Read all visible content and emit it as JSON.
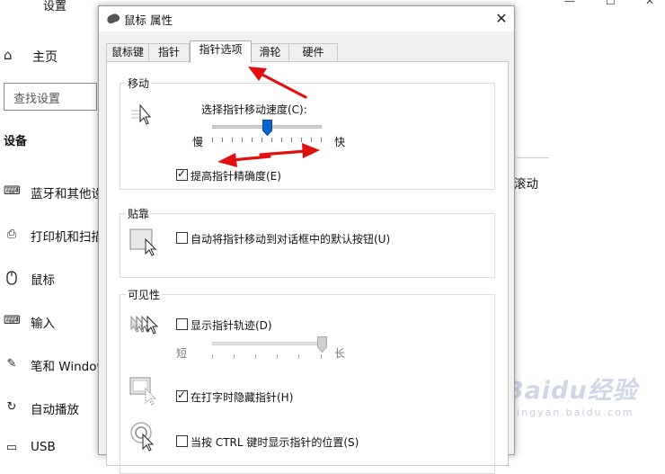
{
  "background": {
    "window_title": "设置",
    "min_glyph": "—",
    "max_glyph": "☐",
    "close_glyph": "✕",
    "home": "主页",
    "search_placeholder": "查找设置",
    "section": "设备",
    "items": [
      {
        "label": "蓝牙和其他设",
        "icon": "keyboard-icon"
      },
      {
        "label": "打印机和扫描",
        "icon": "printer-icon"
      },
      {
        "label": "鼠标",
        "icon": "mouse-icon"
      },
      {
        "label": "输入",
        "icon": "keyboard-icon"
      },
      {
        "label": "笔和 Window",
        "icon": "pen-icon"
      },
      {
        "label": "自动播放",
        "icon": "autoplay-icon"
      },
      {
        "label": "USB",
        "icon": "usb-icon"
      }
    ],
    "right_text": "滚动",
    "watermark_big": "Baidu经验",
    "watermark_small": "jingyan.baidu.com"
  },
  "dialog": {
    "title": "鼠标 属性",
    "tabs": [
      "鼠标键",
      "指针",
      "指针选项",
      "滑轮",
      "硬件"
    ],
    "active_tab": 2,
    "motion": {
      "group": "移动",
      "speed_label": "选择指针移动速度(C):",
      "slow": "慢",
      "fast": "快",
      "speed_level": 0.5,
      "precision_label": "提高指针精确度(E)",
      "precision_checked": true
    },
    "snap": {
      "group": "贴靠",
      "label": "自动将指针移动到对话框中的默认按钮(U)",
      "checked": false
    },
    "visibility": {
      "group": "可见性",
      "trails_label": "显示指针轨迹(D)",
      "trails_checked": false,
      "short": "短",
      "long": "长",
      "trail_level": 1.0,
      "hide_label": "在打字时隐藏指针(H)",
      "hide_checked": true,
      "ctrl_label": "当按 CTRL 键时显示指针的位置(S)",
      "ctrl_checked": false
    }
  },
  "colors": {
    "annotation_arrow": "#e01010",
    "slider_thumb": "#0a64d0",
    "dialog_bg": "#f0f0f0"
  }
}
